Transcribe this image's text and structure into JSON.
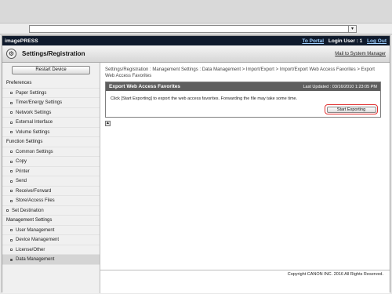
{
  "topbar": {
    "brand": "imagePRESS",
    "portal_link": "To Portal",
    "login_user": "Login User : 1",
    "logout": "Log Out"
  },
  "header": {
    "title": "Settings/Registration",
    "mail_link": "Mail to System Manager"
  },
  "sidebar": {
    "restart_label": "Restart Device",
    "sections": [
      {
        "label": "Preferences",
        "items": [
          "Paper Settings",
          "Timer/Energy Settings",
          "Network Settings",
          "External Interface",
          "Volume Settings"
        ]
      },
      {
        "label": "Function Settings",
        "items": [
          "Common Settings",
          "Copy",
          "Printer",
          "Send",
          "Receive/Forward",
          "Store/Access Files"
        ]
      },
      {
        "label": "Set Destination",
        "items": []
      },
      {
        "label": "Management Settings",
        "items": [
          "User Management",
          "Device Management",
          "License/Other",
          "Data Management"
        ]
      }
    ],
    "active_item": "Data Management"
  },
  "main": {
    "breadcrumb": "Settings/Registration : Management Settings : Data Management > Import/Export > Import/Export Web Access Favorites > Export Web Access Favorites",
    "panel_title": "Export Web Access Favorites",
    "last_updated": "Last Updated : 03/16/2010 1:23:05 PM",
    "message": "Click [Start Exporting] to export the web access favorites. Forwarding the file may take some time.",
    "start_button": "Start Exporting"
  },
  "footer": {
    "copyright": "Copyright CANON INC. 2016 All Rights Reserved."
  }
}
